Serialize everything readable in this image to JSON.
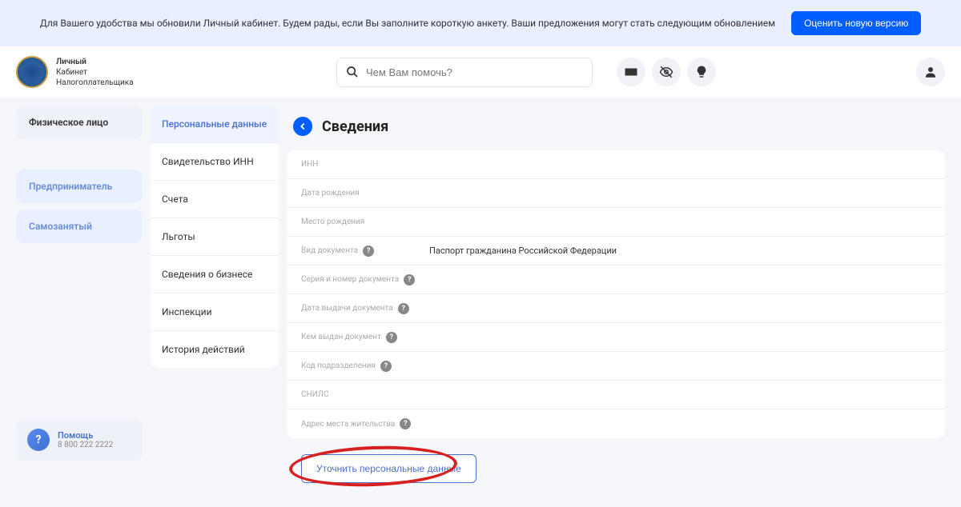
{
  "notification": {
    "text": "Для Вашего удобства мы обновили Личный кабинет. Будем рады, если Вы заполните короткую анкету. Ваши предложения могут стать следующим обновлением",
    "button": "Оценить новую версию"
  },
  "logo": {
    "line1": "Личный",
    "line2": "Кабинет",
    "line3": "Налогоплательщика"
  },
  "search": {
    "placeholder": "Чем Вам помочь?"
  },
  "sidebar": {
    "items": [
      {
        "label": "Физическое лицо",
        "active": true
      },
      {
        "label": "Предприниматель",
        "active": false
      },
      {
        "label": "Самозанятый",
        "active": false
      }
    ]
  },
  "help": {
    "title": "Помощь",
    "phone": "8 800 222 2222"
  },
  "page": {
    "title": "Сведения"
  },
  "tabs": [
    {
      "label": "Персональные данные",
      "active": true
    },
    {
      "label": "Свидетельство ИНН",
      "active": false
    },
    {
      "label": "Счета",
      "active": false
    },
    {
      "label": "Льготы",
      "active": false
    },
    {
      "label": "Сведения о бизнесе",
      "active": false
    },
    {
      "label": "Инспекции",
      "active": false
    },
    {
      "label": "История действий",
      "active": false
    }
  ],
  "fields": [
    {
      "label": "ИНН",
      "value": "",
      "help": false
    },
    {
      "label": "Дата рождения",
      "value": "",
      "help": false
    },
    {
      "label": "Место рождения",
      "value": "",
      "help": false
    },
    {
      "label": "Вид документа",
      "value": "Паспорт гражданина Российской Федерации",
      "help": true
    },
    {
      "label": "Серия и номер документа",
      "value": "",
      "help": true
    },
    {
      "label": "Дата выдачи документа",
      "value": "",
      "help": true
    },
    {
      "label": "Кем выдан документ",
      "value": "",
      "help": true
    },
    {
      "label": "Код подразделения",
      "value": "",
      "help": true
    },
    {
      "label": "СНИЛС",
      "value": "",
      "help": false
    },
    {
      "label": "Адрес места жительства",
      "value": "",
      "help": true
    }
  ],
  "action": {
    "button": "Уточнить персональные данные"
  }
}
